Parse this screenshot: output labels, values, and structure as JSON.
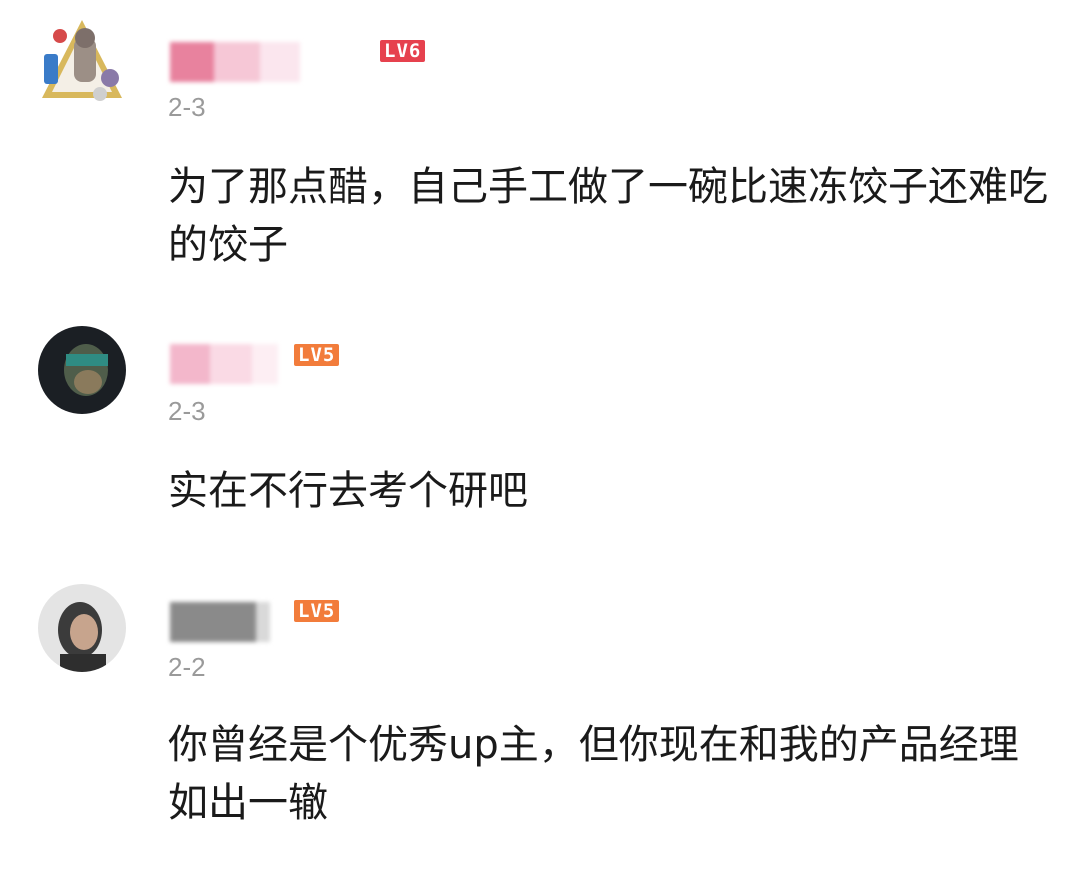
{
  "comments": [
    {
      "avatar": "cartoon-avatar-icon",
      "level": "LV6",
      "level_color": "#e6414e",
      "date": "2-3",
      "text": "为了那点醋，自己手工做了一碗比速冻饺子还难吃的饺子"
    },
    {
      "avatar": "dark-portrait-avatar-icon",
      "level": "LV5",
      "level_color": "#f27c3b",
      "date": "2-3",
      "text": "实在不行去考个研吧"
    },
    {
      "avatar": "photo-avatar-icon",
      "level": "LV5",
      "level_color": "#f27c3b",
      "date": "2-2",
      "text": "你曾经是个优秀up主，但你现在和我的产品经理如出一辙"
    }
  ]
}
